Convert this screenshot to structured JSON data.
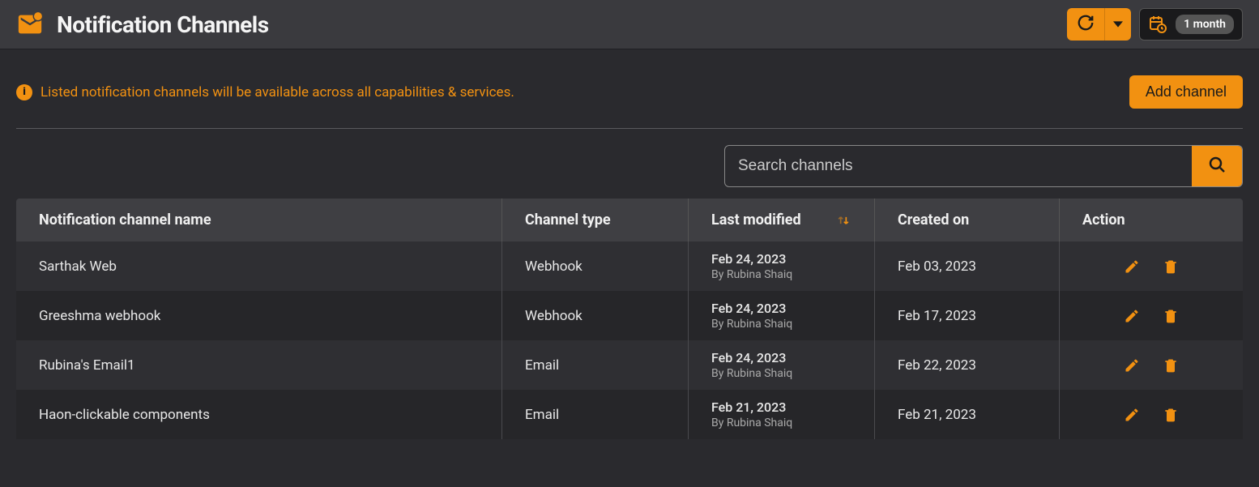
{
  "header": {
    "title": "Notification Channels",
    "time_range": "1 month"
  },
  "info": {
    "text": "Listed notification channels will be available across all capabilities & services.",
    "add_button": "Add channel"
  },
  "search": {
    "placeholder": "Search channels"
  },
  "table": {
    "headers": {
      "name": "Notification channel name",
      "type": "Channel type",
      "modified": "Last modified",
      "created": "Created on",
      "action": "Action"
    },
    "rows": [
      {
        "name": "Sarthak Web",
        "type": "Webhook",
        "modified_date": "Feb 24, 2023",
        "modified_by": "By Rubina Shaiq",
        "created": "Feb 03, 2023"
      },
      {
        "name": "Greeshma webhook",
        "type": "Webhook",
        "modified_date": "Feb 24, 2023",
        "modified_by": "By Rubina Shaiq",
        "created": "Feb 17, 2023"
      },
      {
        "name": "Rubina's Email1",
        "type": "Email",
        "modified_date": "Feb 24, 2023",
        "modified_by": "By Rubina Shaiq",
        "created": "Feb 22, 2023"
      },
      {
        "name": "Haon-clickable components",
        "type": "Email",
        "modified_date": "Feb 21, 2023",
        "modified_by": "By Rubina Shaiq",
        "created": "Feb 21, 2023"
      }
    ]
  }
}
